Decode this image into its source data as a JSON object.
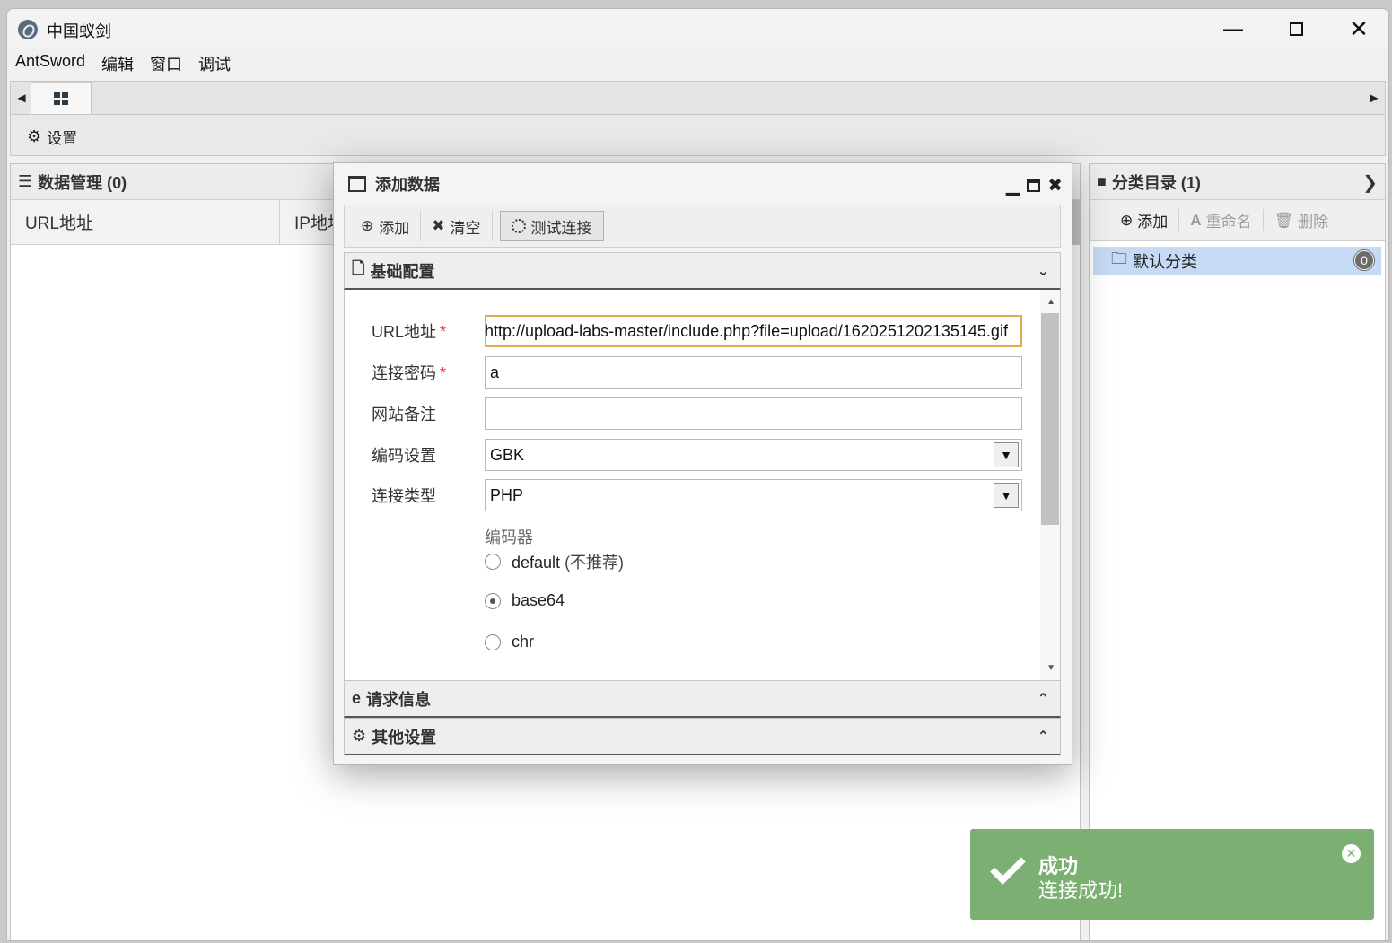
{
  "window": {
    "title": "中国蚁剑"
  },
  "menu": [
    "AntSword",
    "编辑",
    "窗口",
    "调试"
  ],
  "toolbar": {
    "settings_label": "设置"
  },
  "data_panel": {
    "title": "数据管理 (0)",
    "columns": [
      "URL地址",
      "IP地址"
    ]
  },
  "category_panel": {
    "title": "分类目录 (1)",
    "add_label": "添加",
    "rename_label": "重命名",
    "delete_label": "删除",
    "item_label": "默认分类",
    "item_count": "0"
  },
  "dialog": {
    "title": "添加数据",
    "add_label": "添加",
    "clear_label": "清空",
    "test_label": "测试连接",
    "section_basic": "基础配置",
    "section_request": "请求信息",
    "section_other": "其他设置",
    "fields": {
      "url_label": "URL地址",
      "url_value": "http://upload-labs-master/include.php?file=upload/1620251202135145.gif",
      "password_label": "连接密码",
      "password_value": "a",
      "note_label": "网站备注",
      "note_value": "",
      "encoding_label": "编码设置",
      "encoding_value": "GBK",
      "type_label": "连接类型",
      "type_value": "PHP",
      "required_mark": "*"
    },
    "encoder": {
      "label": "编码器",
      "options": [
        "default",
        "base64",
        "chr"
      ],
      "default_note": "(不推荐)",
      "selected": "base64"
    }
  },
  "toast": {
    "title": "成功",
    "message": "连接成功!"
  },
  "colors": {
    "toast_bg": "#7cb072",
    "selected_row": "#c6d9f5",
    "focus_border": "#e0a94a",
    "required": "#e54040"
  }
}
